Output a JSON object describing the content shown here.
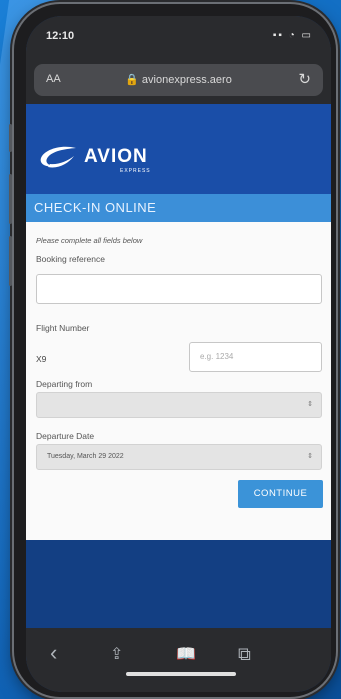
{
  "status": {
    "time": "12:10",
    "icons": "▪▪ ◔ ▭"
  },
  "browser": {
    "aa_label": "AA",
    "url": "🔒 avionexpress.aero",
    "reload_icon": "↻"
  },
  "brand": {
    "name": "AVION",
    "sub": "EXPRESS"
  },
  "page": {
    "title": "CHECK-IN ONLINE",
    "instruction": "Please complete all fields below"
  },
  "form": {
    "booking_label": "Booking reference",
    "booking_value": "",
    "flight_label": "Flight Number",
    "flight_prefix": "X9",
    "flight_placeholder": "e.g. 1234",
    "departing_label": "Departing from",
    "departing_value": "",
    "date_label": "Departure Date",
    "date_value": "Tuesday, March 29 2022",
    "continue_label": "CONTINUE"
  },
  "toolbar": {
    "back": "‹",
    "share": "⇪",
    "bookmarks": "📖",
    "tabs": "⧉"
  },
  "colors": {
    "header_blue": "#1a4ea8",
    "title_bar": "#3c8fd8",
    "button": "#3b93d8"
  }
}
